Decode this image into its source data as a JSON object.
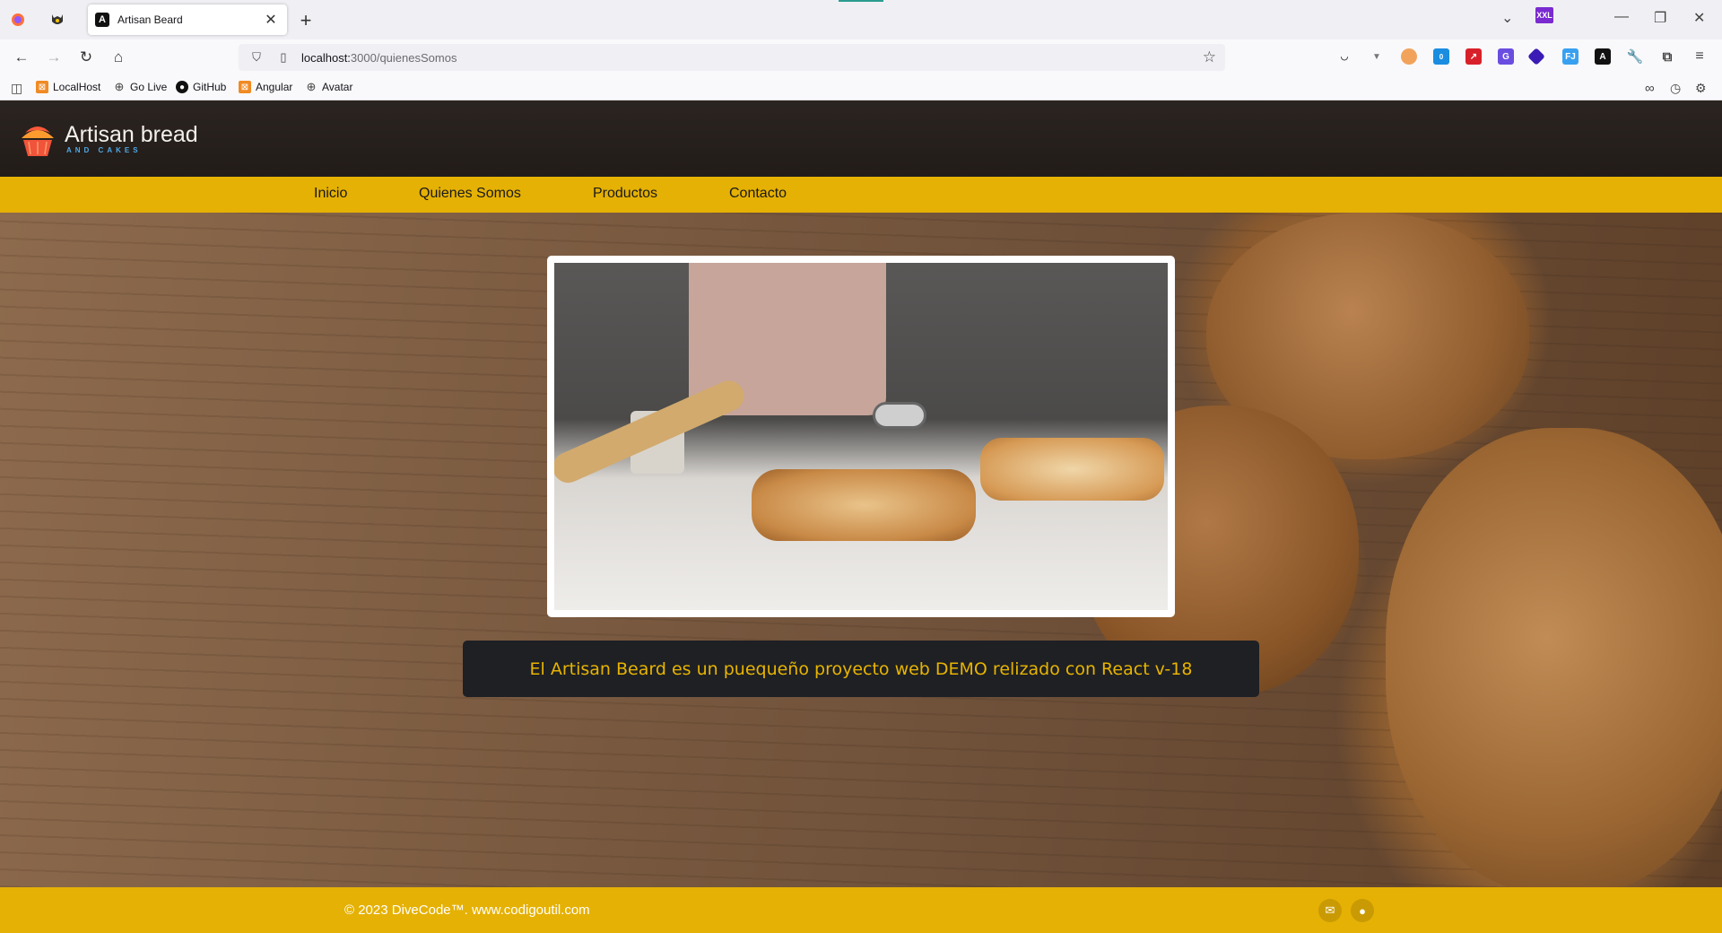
{
  "browser": {
    "tab_title": "Artisan Beard",
    "tab_favicon": "A",
    "url_host": "localhost:",
    "url_path": "3000/quienesSomos",
    "bookmarks": [
      "LocalHost",
      "Go Live",
      "GitHub",
      "Angular",
      "Avatar"
    ],
    "extensions_badge": "0",
    "xxl_badge": "XXL"
  },
  "site": {
    "logo_main": "Artisan bread",
    "logo_sub": "AND CAKES",
    "menu": [
      "Inicio",
      "Quienes Somos",
      "Productos",
      "Contacto"
    ],
    "caption": "El Artisan Beard es un puequeño proyecto web DEMO relizado con React v-18",
    "footer_text": "© 2023 DiveCode™. www.codigoutil.com"
  },
  "colors": {
    "menu_bar": "#e5b104",
    "header_bg": "#2b2420",
    "caption_bg": "#1e2024",
    "caption_text": "#e8b400"
  },
  "icons": {
    "footer": [
      "envelope-icon",
      "github-icon"
    ]
  }
}
